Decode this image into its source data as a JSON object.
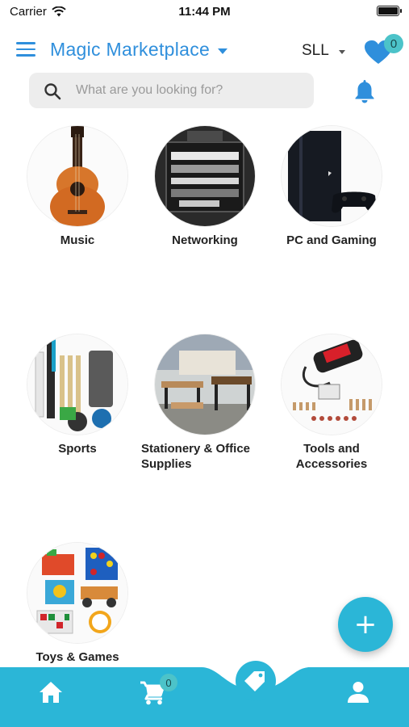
{
  "status_bar": {
    "carrier": "Carrier",
    "time": "11:44 PM"
  },
  "header": {
    "title": "Magic Marketplace",
    "currency": "SLL",
    "wishlist_count": "0"
  },
  "search": {
    "placeholder": "What are you looking for?",
    "value": ""
  },
  "categories": [
    {
      "label": "Music",
      "icon": "acoustic-guitar-image"
    },
    {
      "label": "Networking",
      "icon": "server-rack-image"
    },
    {
      "label": "PC and Gaming",
      "icon": "game-console-image"
    },
    {
      "label": "Sports",
      "icon": "cricket-gear-image"
    },
    {
      "label": "Stationery & Office Supplies",
      "icon": "office-furniture-image"
    },
    {
      "label": "Tools and Accessories",
      "icon": "rotary-tool-kit-image"
    },
    {
      "label": "Toys & Games",
      "icon": "toys-image"
    }
  ],
  "bottom_nav": {
    "cart_count": "0",
    "items": [
      "home-icon",
      "cart-icon",
      "tag-icon",
      "profile-icon"
    ]
  },
  "colors": {
    "accent": "#2f8fdc",
    "teal": "#2bb6d7",
    "badge": "#4cc3c9"
  }
}
